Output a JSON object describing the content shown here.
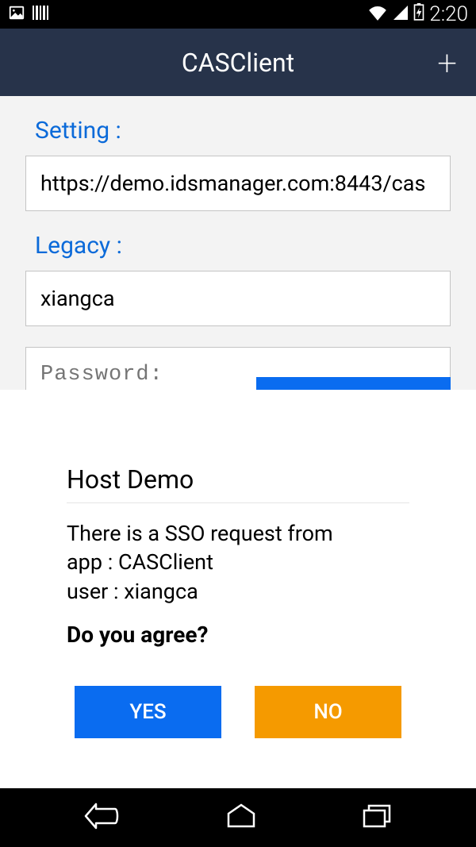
{
  "status": {
    "time": "2:20"
  },
  "appbar": {
    "title": "CASClient"
  },
  "form": {
    "setting_label": "Setting :",
    "setting_value": "https://demo.idsmanager.com:8443/cas",
    "legacy_label": "Legacy :",
    "legacy_value": "xiangca",
    "password_placeholder": "Password:"
  },
  "dialog": {
    "title": "Host Demo",
    "line1": "There is a SSO request from",
    "line2": "app : CASClient",
    "line3": "user : xiangca",
    "question": "Do you agree?",
    "yes": "YES",
    "no": "NO"
  }
}
